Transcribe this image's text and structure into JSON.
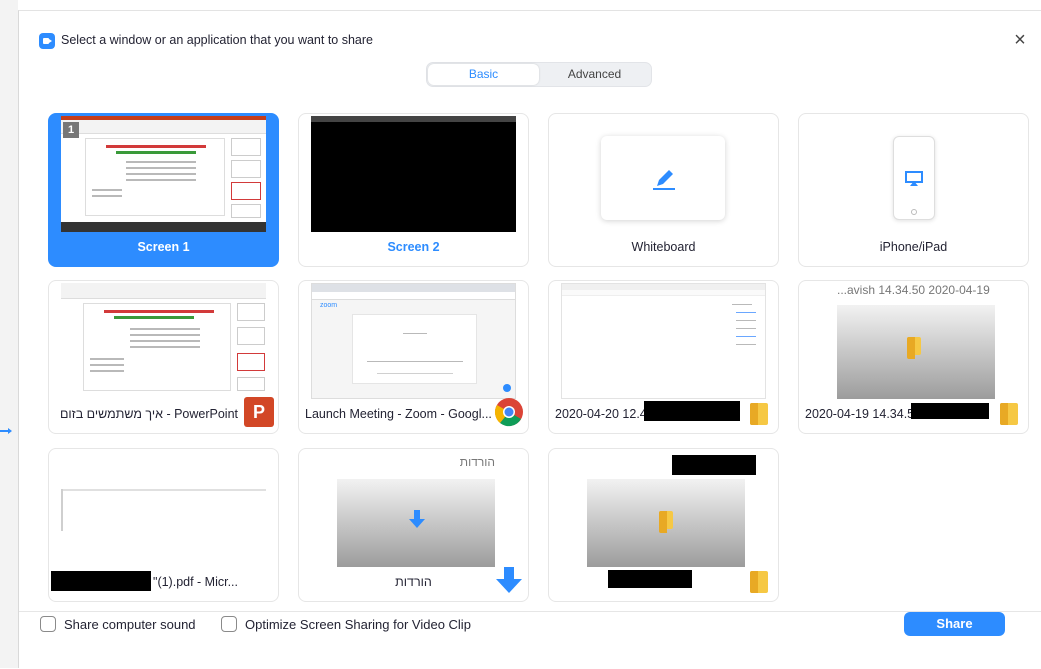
{
  "dialog": {
    "title": "Select a window or an application that you want to share",
    "close_glyph": "×"
  },
  "tabs": {
    "basic": "Basic",
    "advanced": "Advanced",
    "selected": "Basic"
  },
  "screens": [
    {
      "label": "Screen 1",
      "selected": true,
      "badge": "1"
    },
    {
      "label": "Screen 2",
      "selected": false
    }
  ],
  "special": [
    {
      "label": "Whiteboard",
      "icon": "pen-icon"
    },
    {
      "label": "iPhone/iPad",
      "icon": "airplay-icon"
    }
  ],
  "windows": [
    {
      "label": "איך משתמשים בזום - PowerPoint",
      "app_icon": "powerpoint-icon",
      "app_letter": "P"
    },
    {
      "label": "Launch Meeting - Zoom - Googl...",
      "app_icon": "chrome-icon",
      "thumb_logo": "zoom"
    },
    {
      "label": "2020-04-20 12.41.",
      "app_icon": "folder-icon"
    },
    {
      "label": "2020-04-19 14.34.50",
      "thumb_title": "...avish 14.34.50 2020-04-19",
      "app_icon": "folder-icon"
    },
    {
      "label": "(1).pdf - Micr...",
      "label_prefix": "\"",
      "app_icon": "pdf-icon"
    },
    {
      "label": "הורדות",
      "thumb_title": "הורדות",
      "app_icon": "download-icon"
    },
    {
      "label": "",
      "app_icon": "folder-icon"
    }
  ],
  "footer": {
    "share_sound": "Share computer sound",
    "optimize_video": "Optimize Screen Sharing for Video Clip",
    "share_button": "Share"
  },
  "colors": {
    "accent": "#2d8cff",
    "text": "#232333"
  }
}
